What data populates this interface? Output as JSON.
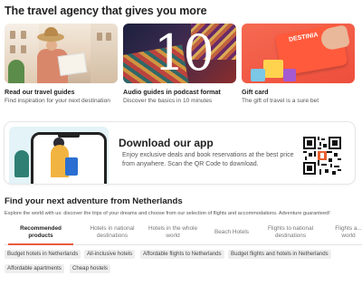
{
  "header": {
    "title": "The travel agency that gives you more"
  },
  "cards": [
    {
      "title": "Read our travel guides",
      "desc": "Find inspiration for your next destination"
    },
    {
      "title": "Audio guides in podcast format",
      "desc": "Discover the basics in 10 minutes",
      "image_text": "10"
    },
    {
      "title": "Gift card",
      "desc": "The gift of travel is a sure bet",
      "image_text": "DESTINIA"
    }
  ],
  "app_banner": {
    "title": "Download our app",
    "desc": "Enjoy exclusive deals and book reservations at the best price from anywhere. Scan the QR Code to download."
  },
  "explore": {
    "title": "Find your next adventure from Netherlands",
    "desc": "Explore the world with us: discover the trips of your dreams and choose from our selection of flights and accommodations. Adventure guaranteed!",
    "tabs": [
      "Recommended products",
      "Hotels in national destinations",
      "Hotels in the whole world",
      "Beach Hotels",
      "Flights to national destinations",
      "Flights a... world"
    ],
    "chips": [
      "Budget hotels in Netherlands",
      "All-inclusive hotels",
      "Affordable flights to Netherlands",
      "Budget flights and hotels in Netherlands",
      "Affordable apartments",
      "Cheap hostels"
    ]
  },
  "colors": {
    "accent": "#e85a3f",
    "chip_bg": "#eeeeee"
  }
}
